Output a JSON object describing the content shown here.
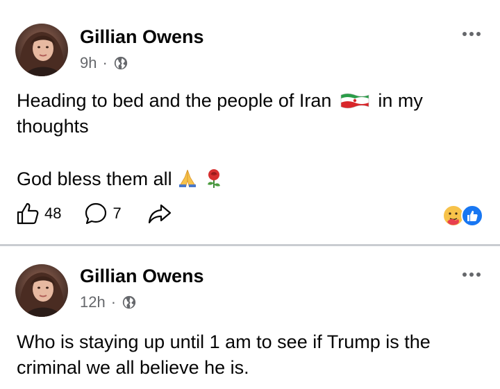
{
  "posts": [
    {
      "author": "Gillian Owens",
      "time": "9h",
      "separator": "·",
      "text_line1_before": "Heading to bed and the people of Iran",
      "text_line1_after": "in my",
      "text_line2": "thoughts",
      "text_line3": "God bless them all",
      "likes": "48",
      "comments": "7",
      "privacy_icon": "globe-icon",
      "emojis": [
        "iran-flag",
        "folded-hands",
        "rose"
      ],
      "reaction_icons": [
        "care-reaction",
        "like-reaction"
      ]
    },
    {
      "author": "Gillian Owens",
      "time": "12h",
      "separator": "·",
      "text_line1": "Who is staying up until 1 am to see if Trump is the",
      "text_line2": "criminal we all believe he is.",
      "privacy_icon": "globe-icon"
    }
  ],
  "colors": {
    "text_primary": "#050505",
    "text_secondary": "#65676b",
    "divider": "#c9ccd1",
    "like_blue": "#1877f2"
  }
}
